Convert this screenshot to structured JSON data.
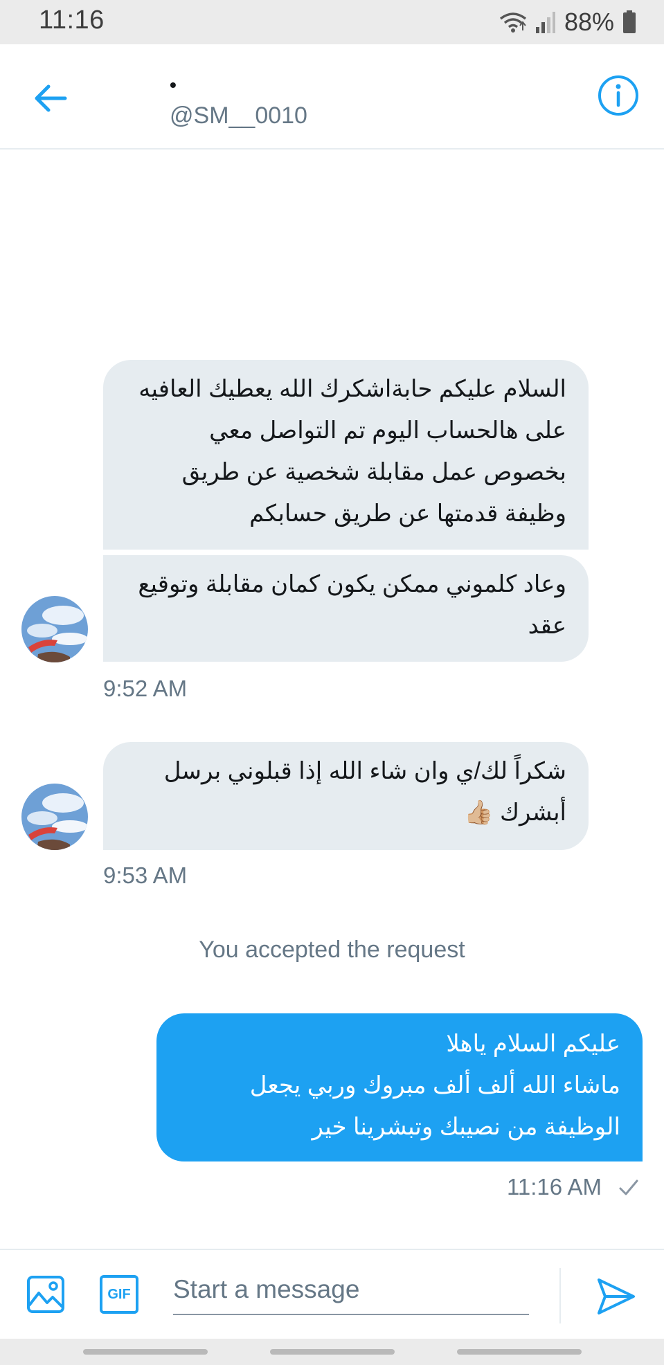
{
  "status_bar": {
    "time": "11:16",
    "battery": "88%",
    "icons": [
      "wifi-icon",
      "signal-icon",
      "battery-icon"
    ]
  },
  "header": {
    "name": "•",
    "handle": "@SM__0010",
    "back_icon": "arrow-left-icon",
    "info_icon": "info-icon"
  },
  "messages": [
    {
      "direction": "incoming",
      "lines": [
        "السلام عليكم حابةاشكرك الله يعطيك العافيه",
        "على هالحساب اليوم تم التواصل معي",
        "بخصوص عمل مقابلة شخصية عن طريق",
        "وظيفة قدمتها عن طريق حسابكم"
      ]
    },
    {
      "direction": "incoming",
      "lines": [
        "وعاد كلموني ممكن يكون كمان مقابلة وتوقيع",
        "عقد"
      ],
      "time": "9:52 AM"
    },
    {
      "direction": "incoming",
      "lines": [
        "شكراً لك/ي وان شاء الله إذا قبلوني برسل",
        "أبشرك 👍🏼"
      ],
      "time": "9:53 AM"
    },
    {
      "direction": "outgoing",
      "lines": [
        "عليكم السلام ياهلا",
        "ماشاء الله ألف ألف مبروك وربي يجعل",
        "الوظيفة من نصيبك وتبشرينا خير"
      ],
      "time": "11:16 AM",
      "status_icon": "checkmark-icon"
    }
  ],
  "system_note": "You accepted the request",
  "composer": {
    "placeholder": "Start a message",
    "value": "",
    "gif_label": "GIF",
    "media_icon": "image-icon",
    "send_icon": "send-icon"
  },
  "colors": {
    "accent": "#1da1f2",
    "incoming_bubble": "#e6ecf0",
    "secondary_text": "#657786"
  }
}
